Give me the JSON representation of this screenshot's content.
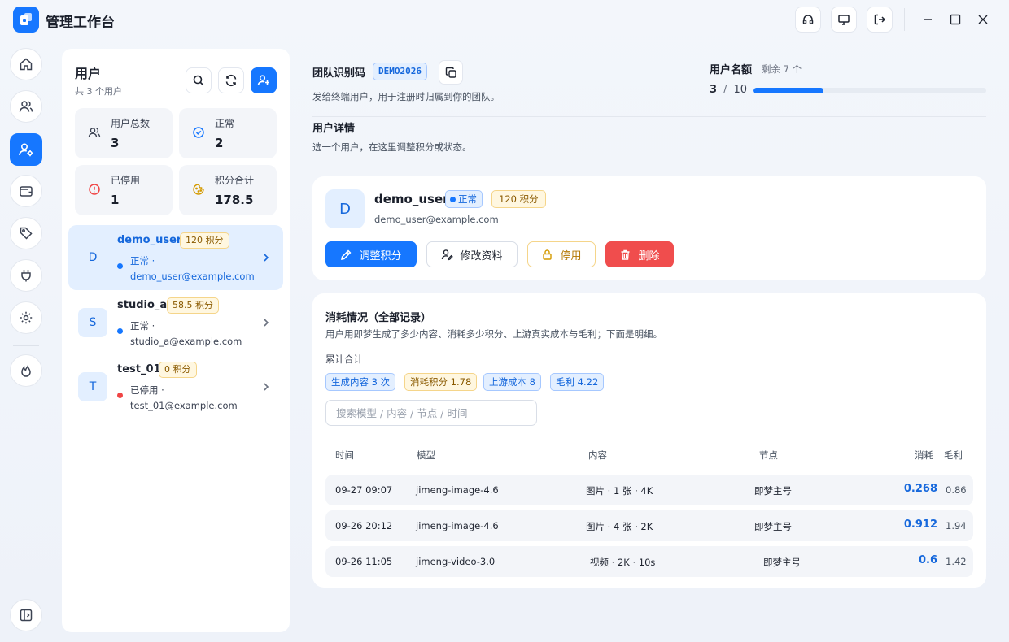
{
  "app": {
    "title": "管理工作台"
  },
  "users_panel": {
    "title": "用户",
    "subtitle": "共 3 个用户",
    "stats": [
      {
        "label": "用户总数",
        "value": "3",
        "icon": "users-icon"
      },
      {
        "label": "正常",
        "value": "2",
        "icon": "check-circle-icon"
      },
      {
        "label": "已停用",
        "value": "1",
        "icon": "alert-circle-icon"
      },
      {
        "label": "积分合计",
        "value": "178.5",
        "icon": "cookie-icon"
      }
    ],
    "users": [
      {
        "initial": "D",
        "name": "demo_user",
        "points": "120 积分",
        "status": "正常 ·",
        "email": "demo_user@example.com",
        "status_color": "#1677ff"
      },
      {
        "initial": "S",
        "name": "studio_a",
        "points": "58.5 积分",
        "status": "正常 ·",
        "email": "studio_a@example.com",
        "status_color": "#1677ff"
      },
      {
        "initial": "T",
        "name": "test_01",
        "points": "0 积分",
        "status": "已停用 ·",
        "email": "test_01@example.com",
        "status_color": "#f04545"
      }
    ]
  },
  "team": {
    "label": "团队识别码",
    "code": "DEMO2026",
    "description": "发给终端用户，用于注册时归属到你的团队。"
  },
  "quota": {
    "label": "用户名额",
    "remaining": "剩余 7 个",
    "used": "3",
    "separator": "/",
    "total": "10",
    "fraction": 0.3
  },
  "user_detail": {
    "title": "用户详情",
    "subtitle": "选一个用户，在这里调整积分或状态。",
    "initial": "D",
    "name": "demo_user",
    "status": "正常",
    "points": "120 积分",
    "email": "demo_user@example.com",
    "actions": {
      "adjust": "调整积分",
      "edit": "修改资料",
      "disable": "停用",
      "delete": "删除"
    }
  },
  "consumption": {
    "title": "消耗情况（全部记录）",
    "description": "用户用即梦生成了多少内容、消耗多少积分、上游真实成本与毛利；下面是明细。",
    "summary_label": "累计合计",
    "chips": [
      "生成内容 3 次",
      "消耗积分 1.78",
      "上游成本 8",
      "毛利 4.22"
    ],
    "search_placeholder": "搜索模型 / 内容 / 节点 / 时间",
    "columns": {
      "time": "时间",
      "model": "模型",
      "content": "内容",
      "node": "节点",
      "cost": "消耗",
      "profit": "毛利"
    },
    "rows": [
      {
        "time": "09-27 09:07",
        "model": "jimeng-image-4.6",
        "content": "图片 · 1 张 · 4K",
        "node": "即梦主号",
        "cost": "0.268",
        "profit": "0.86"
      },
      {
        "time": "09-26 20:12",
        "model": "jimeng-image-4.6",
        "content": "图片 · 4 张 · 2K",
        "node": "即梦主号",
        "cost": "0.912",
        "profit": "1.94"
      },
      {
        "time": "09-26 11:05",
        "model": "jimeng-video-3.0",
        "content": "视频 · 2K · 10s",
        "node": "即梦主号",
        "cost": "0.6",
        "profit": "1.42"
      }
    ]
  },
  "colors": {
    "accent": "#1677ff",
    "danger": "#f04545",
    "warning": "#f5d58a"
  }
}
